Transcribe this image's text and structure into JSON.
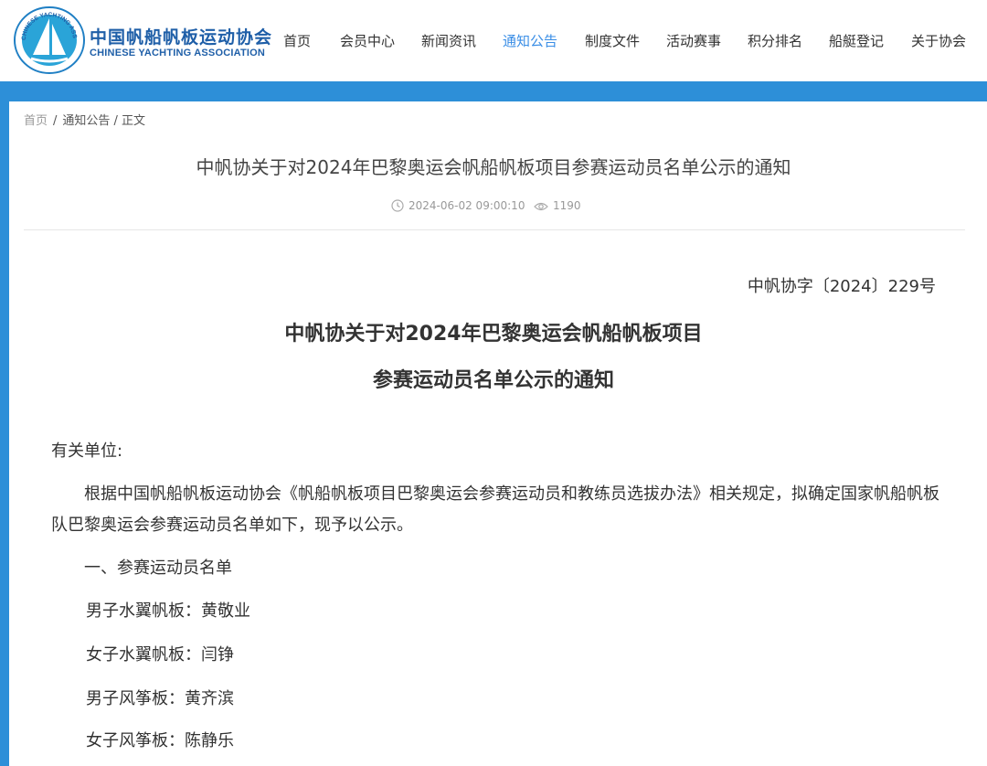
{
  "header": {
    "org_name_cn": "中国帆船帆板运动协会",
    "org_name_en": "CHINESE YACHTING ASSOCIATION",
    "logo_ring_text": "CHINESE YACHTING ASSOCIATION",
    "logo_icon": "sailboat-logo-icon"
  },
  "nav": {
    "items": [
      {
        "label": "首页"
      },
      {
        "label": "会员中心"
      },
      {
        "label": "新闻资讯"
      },
      {
        "label": "通知公告",
        "active": true
      },
      {
        "label": "制度文件"
      },
      {
        "label": "活动赛事"
      },
      {
        "label": "积分排名"
      },
      {
        "label": "船艇登记"
      },
      {
        "label": "关于协会"
      }
    ],
    "active_color": "#3a8ee6"
  },
  "breadcrumb": {
    "home": "首页",
    "sep": "/",
    "current": "通知公告 / 正文"
  },
  "article": {
    "title": "中帆协关于对2024年巴黎奥运会帆船帆板项目参赛运动员名单公示的通知",
    "datetime": "2024-06-02 09:00:10",
    "views": "1190",
    "time_icon": "clock-icon",
    "views_icon": "eye-icon"
  },
  "doc": {
    "number": "中帆协字〔2024〕229号",
    "title_line1": "中帆协关于对2024年巴黎奥运会帆船帆板项目",
    "title_line2": "参赛运动员名单公示的通知",
    "salutation": "有关单位:",
    "para1_line1": "根据中国帆船帆板运动协会《帆船帆板项目巴黎奥运会参赛运动员和教练员选拔办法》相关规定，拟确定国家帆船帆板",
    "para1_line2": "队巴黎奥运会参赛运动员名单如下，现予以公示。",
    "section1": "一、参赛运动员名单",
    "entries": [
      "男子水翼帆板：黄敬业",
      "女子水翼帆板：闫铮",
      "男子风筝板：黄齐滨",
      "女子风筝板：陈静乐"
    ]
  },
  "colors": {
    "band": "#2d8fd8",
    "brand": "#1f5fa8"
  }
}
